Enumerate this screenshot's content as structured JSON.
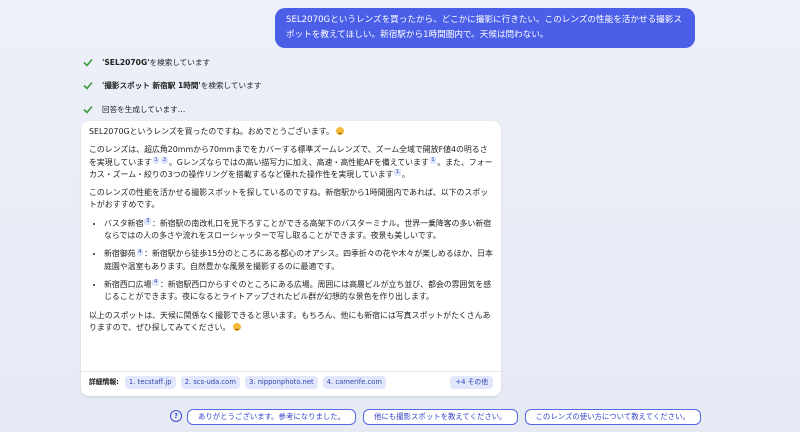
{
  "user_message": "SEL2070Gというレンズを買ったから、どこかに撮影に行きたい。このレンズの性能を活かせる撮影スポットを教えてほしい。新宿駅から1時間圏内で。天候は問わない。",
  "steps": [
    {
      "bold": "'SEL2070G'",
      "text": " を検索しています"
    },
    {
      "bold": "'撮影スポット 新宿駅 1時間'",
      "text": " を検索しています"
    },
    {
      "bold": "",
      "text": "回答を生成しています…"
    }
  ],
  "answer": {
    "greeting": "SEL2070Gというレンズを買ったのですね。おめでとうございます。",
    "para1_a": "このレンズは、超広角20mmから70mmまでをカバーする標準ズームレンズで、ズーム全域で開放F値4の明るさを実現しています",
    "para1_b": "。Gレンズならではの高い描写力に加え、高速・高性能AFを備えています",
    "para1_c": "。また、フォーカス・ズーム・絞りの3つの操作リングを搭載するなど優れた操作性を実現しています",
    "para1_d": "。",
    "para2": "このレンズの性能を活かせる撮影スポットを探しているのですね。新宿駅から1時間圏内であれば、以下のスポットがおすすめです。",
    "spots": [
      {
        "name": "バスタ新宿",
        "ref": "3",
        "desc": "：新宿駅の南改札口を見下ろすことができる高架下のバスターミナル。世界一乗降客の多い新宿ならではの人の多さや流れをスローシャッターで写し取ることができます。夜景も美しいです。"
      },
      {
        "name": "新宿御苑",
        "ref": "4",
        "desc": "：新宿駅から徒歩15分のところにある都心のオアシス。四季折々の花や木々が楽しめるほか、日本庭園や温室もあります。自然豊かな風景を撮影するのに最適です。"
      },
      {
        "name": "新宿西口広場",
        "ref": "4",
        "desc": "：新宿駅西口からすぐのところにある広場。周囲には高層ビルが立ち並び、都会の雰囲気を感じることができます。夜になるとライトアップされたビル群が幻想的な景色を作り出します。"
      }
    ],
    "closing": "以上のスポットは、天候に関係なく撮影できると思います。もちろん、他にも新宿には写真スポットがたくさんありますので、ぜひ探してみてください。",
    "refs": {
      "r1": "1",
      "r2": "2"
    }
  },
  "sources": {
    "label": "詳細情報:",
    "items": [
      "1. tecstaff.jp",
      "2. scs-uda.com",
      "3. nipponphoto.net",
      "4. camerife.com"
    ],
    "more": "+4 その他"
  },
  "suggestions": [
    "ありがとうございます。参考になりました。",
    "他にも撮影スポットを教えてください。",
    "このレンズの使い方について教えてください。"
  ],
  "colors": {
    "accent": "#4b5ee8",
    "check": "#3a9a3a"
  }
}
